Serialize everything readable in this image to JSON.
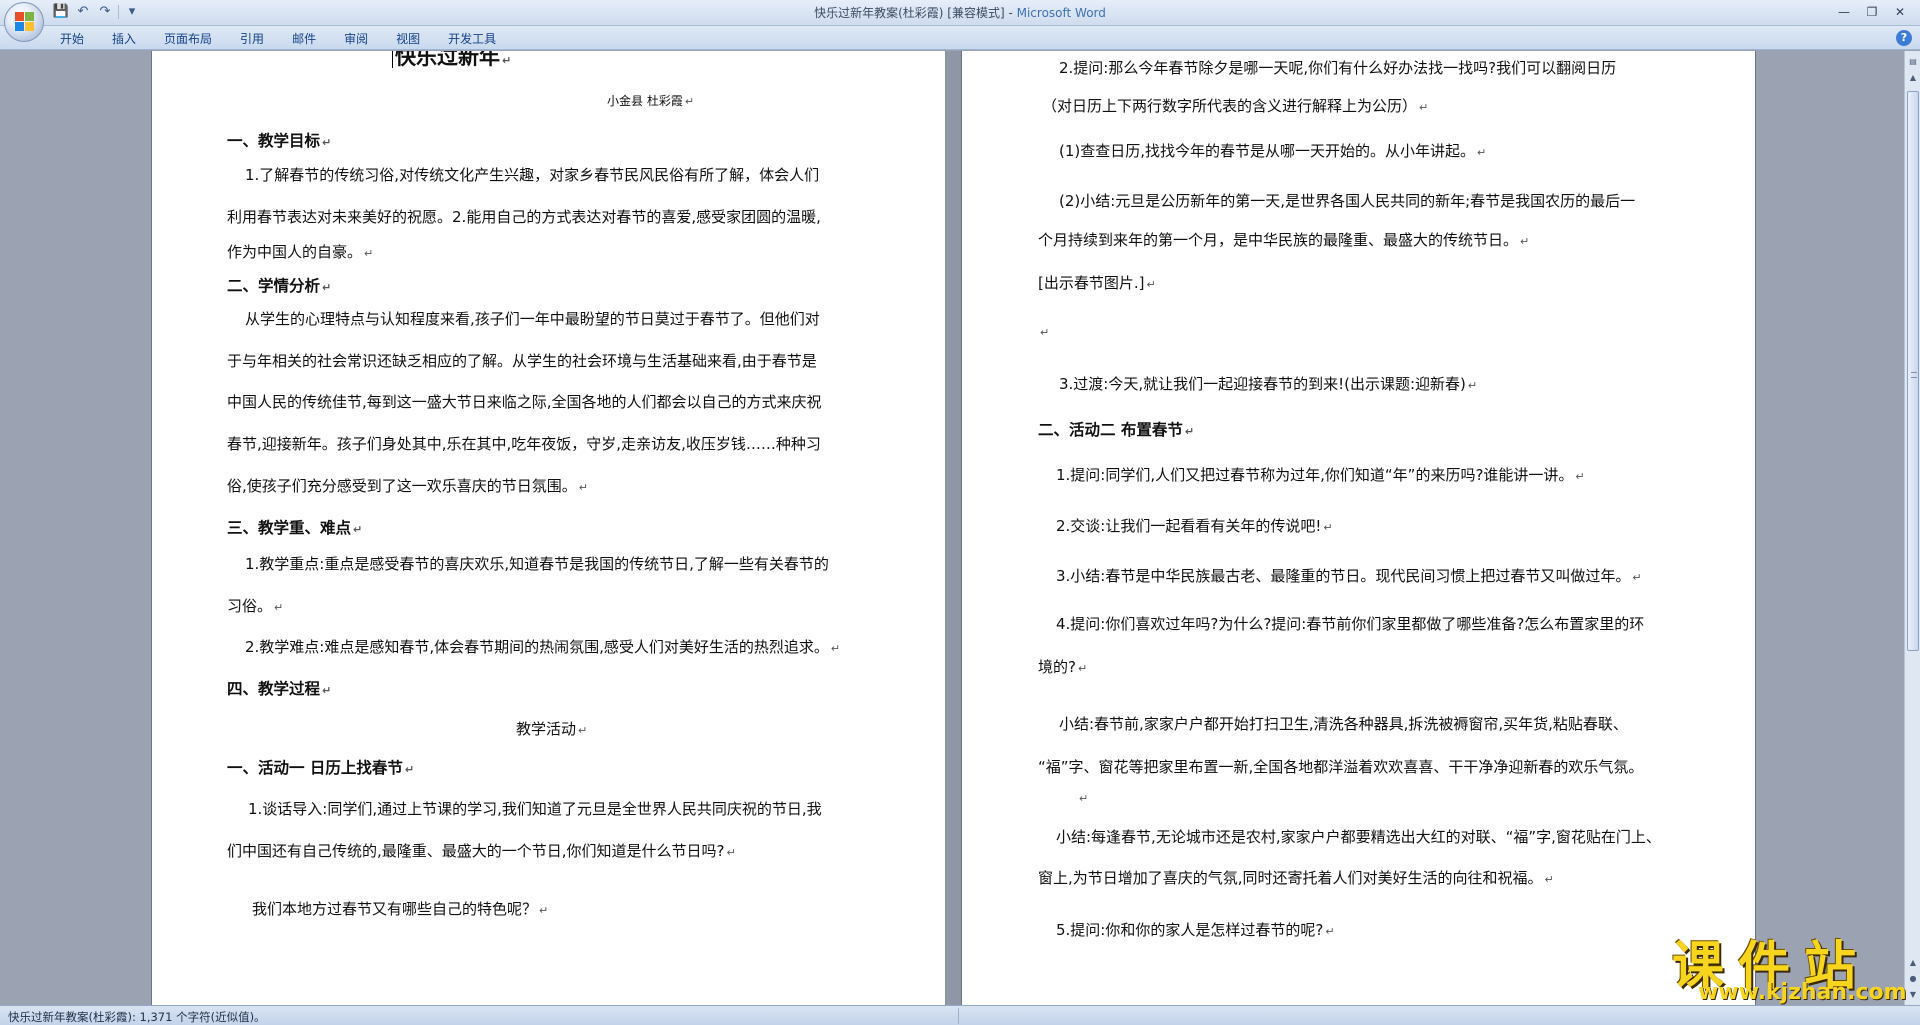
{
  "window": {
    "title_doc": "快乐过新年教案(杜彩霞) [兼容模式]",
    "title_sep": " - ",
    "title_app": "Microsoft Word"
  },
  "qat": {
    "save_icon": "💾",
    "undo_icon": "↶",
    "redo_icon": "↷",
    "more_icon": "▾"
  },
  "win_controls": {
    "minimize": "—",
    "restore": "❐",
    "close": "✕"
  },
  "menu": {
    "tabs": [
      "开始",
      "插入",
      "页面布局",
      "引用",
      "邮件",
      "审阅",
      "视图",
      "开发工具"
    ],
    "help": "?"
  },
  "page1": {
    "title": "快乐过新年",
    "author": "小金县    杜彩霞",
    "s1_heading": "一、教学目标",
    "s1_p1_l1": "1.了解春节的传统习俗,对传统文化产生兴趣，对家乡春节民风民俗有所了解，体会人们",
    "s1_p1_l2": "利用春节表达对未来美好的祝愿。2.能用自己的方式表达对春节的喜爱,感受家团圆的温暖,",
    "s1_p1_l3": "作为中国人的自豪。",
    "s2_heading": "二、学情分析",
    "s2_l1": "从学生的心理特点与认知程度来看,孩子们一年中最盼望的节日莫过于春节了。但他们对",
    "s2_l2": "于与年相关的社会常识还缺乏相应的了解。从学生的社会环境与生活基础来看,由于春节是",
    "s2_l3": "中国人民的传统佳节,每到这一盛大节日来临之际,全国各地的人们都会以自己的方式来庆祝",
    "s2_l4": "春节,迎接新年。孩子们身处其中,乐在其中,吃年夜饭，守岁,走亲访友,收压岁钱……种种习",
    "s2_l5": "俗,使孩子们充分感受到了这一欢乐喜庆的节日氛围。",
    "s3_heading": "三、教学重、难点",
    "s3_p1_l1": "1.教学重点:重点是感受春节的喜庆欢乐,知道春节是我国的传统节日,了解一些有关春节的",
    "s3_p1_l2": "习俗。",
    "s3_p2": "2.教学难点:难点是感知春节,体会春节期间的热闹氛围,感受人们对美好生活的热烈追求。",
    "s4_heading": "四、教学过程",
    "activity_label": "教学活动",
    "act1_heading": "一、活动一   日历上找春节",
    "act1_p1_l1": "1.谈话导入:同学们,通过上节课的学习,我们知道了元旦是全世界人民共同庆祝的节日,我",
    "act1_p1_l2": "们中国还有自己传统的,最隆重、最盛大的一个节日,你们知道是什么节日吗?",
    "act1_p2": "我们本地方过春节又有哪些自己的特色呢？"
  },
  "page2": {
    "q2_l1": "2.提问:那么今年春节除夕是哪一天呢,你们有什么好办法找一找吗?我们可以翻阅日历",
    "q2_l2": "（对日历上下两行数字所代表的含义进行解释上为公历）",
    "q2_1": "(1)查查日历,找找今年的春节是从哪一天开始的。从小年讲起。",
    "q2_2_l1": "(2)小结:元旦是公历新年的第一天,是世界各国人民共同的新年;春节是我国农历的最后一",
    "q2_2_l2": "个月持续到来年的第一个月，是中华民族的最隆重、最盛大的传统节日。",
    "show_pic": "[出示春节图片.]",
    "transition": "3.过渡:今天,就让我们一起迎接春节的到来!(出示课题:迎新春)",
    "act2_heading": "二、活动二        布置春节",
    "a2_1": "1.提问:同学们,人们又把过春节称为过年,你们知道“年”的来历吗?谁能讲一讲。",
    "a2_2": "2.交谈:让我们一起看看有关年的传说吧!",
    "a2_3": "3.小结:春节是中华民族最古老、最隆重的节日。现代民间习惯上把过春节又叫做过年。",
    "a2_4_l1": "4.提问:你们喜欢过年吗?为什么?提问:春节前你们家里都做了哪些准备?怎么布置家里的环",
    "a2_4_l2": "境的?",
    "s1_l1": "小结:春节前,家家户户都开始打扫卫生,清洗各种器具,拆洗被褥窗帘,买年货,粘贴春联、",
    "s1_l2": "“福”字、窗花等把家里布置一新,全国各地都洋溢着欢欢喜喜、干干净净迎新春的欢乐气氛。",
    "s2_l1": "小结:每逢春节,无论城市还是农村,家家户户都要精选出大红的对联、“福”字,窗花贴在门上、",
    "s2_l2": "窗上,为节日增加了喜庆的气氛,同时还寄托着人们对美好生活的向往和祝福。",
    "a2_5": "5.提问:你和你的家人是怎样过春节的呢?"
  },
  "paragraph_mark": "↵",
  "status": {
    "text": "快乐过新年教案(杜彩霞): 1,371 个字符(近似值)。"
  },
  "watermark": {
    "cn": "课件站",
    "url": "www.kjzhan.com"
  },
  "colors": {
    "accent": "#15428b",
    "watermark": "#f7d51e",
    "title_app": "#3f6fb6"
  }
}
